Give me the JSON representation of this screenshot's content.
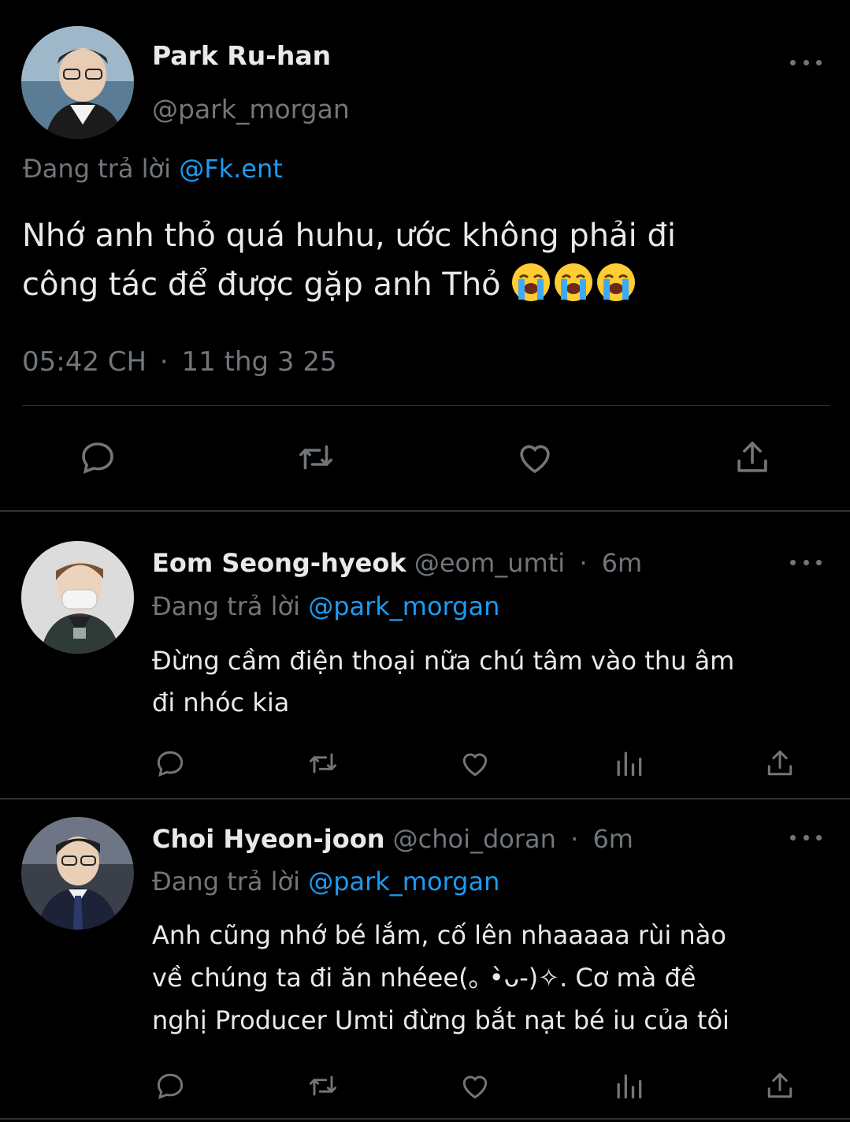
{
  "main_tweet": {
    "author_name": "Park Ru-han",
    "handle": "@park_morgan",
    "replying_prefix": "Đang trả lời",
    "replying_to": "@Fk.ent",
    "text_line1": "Nhớ anh thỏ quá huhu, ước không phải đi",
    "text_line2": "công tác để được gặp anh Thỏ",
    "emoji": [
      "loudly-crying-face",
      "loudly-crying-face",
      "loudly-crying-face"
    ],
    "time": "05:42 CH",
    "separator": "·",
    "date": "11 thg 3 25",
    "actions": [
      "reply-icon",
      "retweet-icon",
      "like-icon",
      "share-icon"
    ]
  },
  "replies": [
    {
      "author_name": "Eom Seong-hyeok",
      "handle": "@eom_umti",
      "separator": "·",
      "age": "6m",
      "replying_prefix": "Đang trả lời",
      "replying_to": "@park_morgan",
      "text_line1": "Đừng cầm điện thoại nữa chú tâm vào thu âm",
      "text_line2": "đi nhóc kia",
      "actions": [
        "reply-icon",
        "retweet-icon",
        "like-icon",
        "views-icon",
        "share-icon"
      ]
    },
    {
      "author_name": "Choi Hyeon-joon",
      "handle": "@choi_doran",
      "separator": "·",
      "age": "6m",
      "replying_prefix": "Đang trả lời",
      "replying_to": "@park_morgan",
      "text_line1": "Anh cũng nhớ bé lắm, cố lên nhaaaaa rùi nào",
      "text_line2": "về chúng ta đi ăn nhéee(｡ •̀ᴗ-)✧. Cơ mà đề",
      "text_line3": "nghị Producer Umti đừng bắt nạt bé iu của tôi",
      "actions": [
        "reply-icon",
        "retweet-icon",
        "like-icon",
        "views-icon",
        "share-icon"
      ]
    }
  ],
  "colors": {
    "background": "#000000",
    "text": "#e7e9ea",
    "muted": "#71767b",
    "link": "#1d9bf0",
    "divider": "#2f3336"
  }
}
